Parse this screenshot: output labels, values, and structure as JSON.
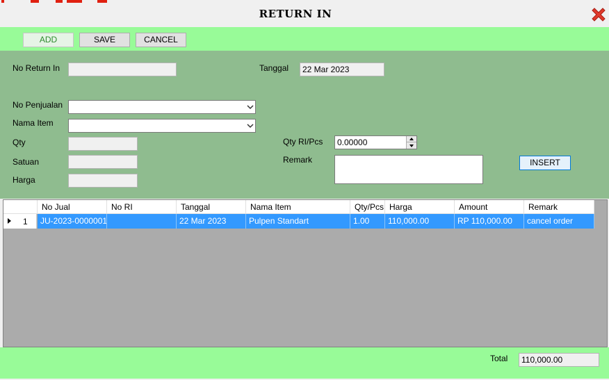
{
  "window": {
    "title": "RETURN IN",
    "close_icon": "close-x-icon",
    "accent_colors": {
      "toolbar": "#98fb98",
      "form": "#8fbc8f",
      "selection": "#3399ff",
      "close": "#e03a2c"
    }
  },
  "toolbar": {
    "add_label": "ADD",
    "save_label": "SAVE",
    "cancel_label": "CANCEL"
  },
  "form": {
    "no_return_in": {
      "label": "No Return In",
      "value": ""
    },
    "tanggal": {
      "label": "Tanggal",
      "value": "22 Mar 2023"
    },
    "no_penjualan": {
      "label": "No Penjualan",
      "value": ""
    },
    "nama_item": {
      "label": "Nama Item",
      "value": ""
    },
    "qty": {
      "label": "Qty",
      "value": ""
    },
    "satuan": {
      "label": "Satuan",
      "value": ""
    },
    "harga": {
      "label": "Harga",
      "value": ""
    },
    "qty_ri_pcs": {
      "label": "Qty RI/Pcs",
      "value": "0.00000"
    },
    "remark": {
      "label": "Remark",
      "value": ""
    },
    "insert_label": "INSERT"
  },
  "grid": {
    "columns": [
      "No Jual",
      "No RI",
      "Tanggal",
      "Nama Item",
      "Qty/Pcs",
      "Harga",
      "Amount",
      "Remark"
    ],
    "rows": [
      {
        "row_number": "1",
        "cells": [
          "JU-2023-0000001",
          "",
          "22 Mar 2023",
          "Pulpen Standart",
          "1.00",
          "110,000.00",
          "RP 110,000.00",
          "cancel order"
        ]
      }
    ]
  },
  "footer": {
    "total_label": "Total",
    "total_value": "110,000.00"
  }
}
